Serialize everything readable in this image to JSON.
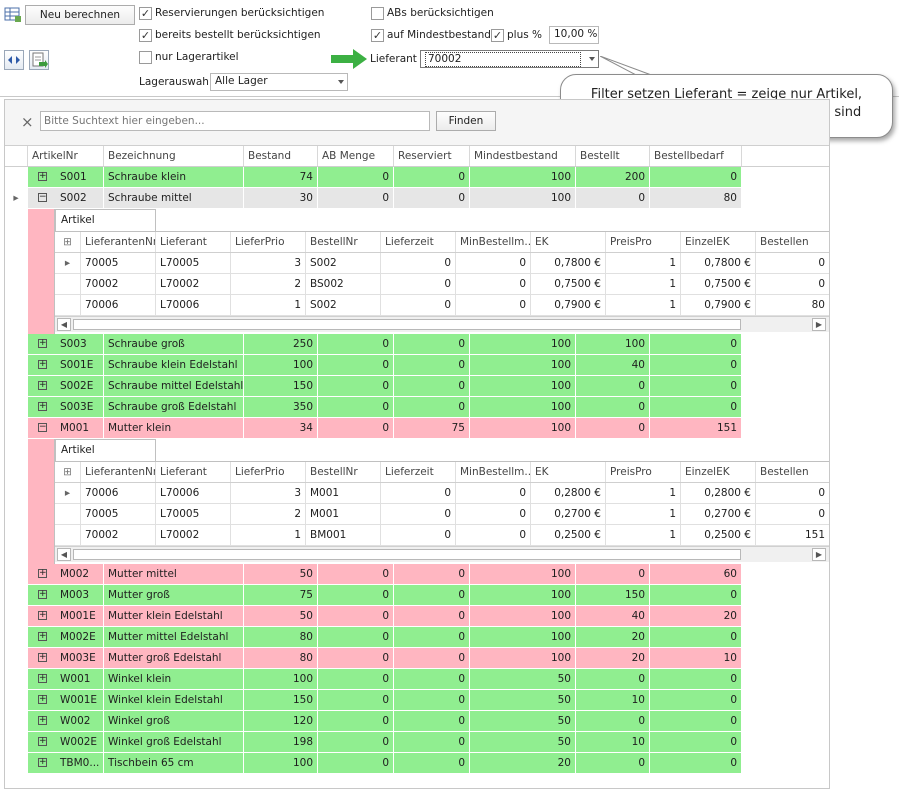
{
  "toolbar": {
    "recalc_label": "Neu berechnen",
    "chk_reservations": {
      "label": "Reservierungen berücksichtigen",
      "checked": true
    },
    "chk_ordered": {
      "label": "bereits bestellt berücksichtigen",
      "checked": true
    },
    "chk_stock_only": {
      "label": "nur Lagerartikel",
      "checked": false
    },
    "chk_abs": {
      "label": "ABs berücksichtigen",
      "checked": false
    },
    "chk_min_stock": {
      "label": "auf Mindestbestand",
      "checked": true
    },
    "chk_plus_percent": {
      "label": "plus %",
      "checked": true
    },
    "percent_value": "10,00 %",
    "supplier_label": "Lieferant",
    "supplier_value": "70002",
    "warehouse_label": "Lagerauswahl",
    "warehouse_value": "Alle Lager",
    "checkmark": "✓"
  },
  "callout": {
    "line1": "Filter setzen Lieferant = zeige nur Artikel,",
    "line2": "die bei diesem Lieferanten erhältlich sind"
  },
  "search": {
    "placeholder": "Bitte Suchtext hier eingeben...",
    "find_label": "Finden",
    "clear_glyph": "×"
  },
  "columns": [
    "ArtikelNr",
    "Bezeichnung",
    "Bestand",
    "AB Menge",
    "Reserviert",
    "Mindestbestand",
    "Bestellt",
    "Bestellbedarf"
  ],
  "rows": [
    {
      "nr": "S001",
      "name": "Schraube klein",
      "bestand": "74",
      "ab": "0",
      "res": "0",
      "min": "100",
      "bestellt": "200",
      "bedarf": "0",
      "color": "green",
      "expanded": false
    },
    {
      "nr": "S002",
      "name": "Schraube mittel",
      "bestand": "30",
      "ab": "0",
      "res": "0",
      "min": "100",
      "bestellt": "0",
      "bedarf": "80",
      "color": "selected",
      "expanded": true
    },
    {
      "nr": "S003",
      "name": "Schraube groß",
      "bestand": "250",
      "ab": "0",
      "res": "0",
      "min": "100",
      "bestellt": "100",
      "bedarf": "0",
      "color": "green",
      "expanded": false
    },
    {
      "nr": "S001E",
      "name": "Schraube klein Edelstahl",
      "bestand": "100",
      "ab": "0",
      "res": "0",
      "min": "100",
      "bestellt": "40",
      "bedarf": "0",
      "color": "green",
      "expanded": false
    },
    {
      "nr": "S002E",
      "name": "Schraube mittel Edelstahl",
      "bestand": "150",
      "ab": "0",
      "res": "0",
      "min": "100",
      "bestellt": "0",
      "bedarf": "0",
      "color": "green",
      "expanded": false
    },
    {
      "nr": "S003E",
      "name": "Schraube groß Edelstahl",
      "bestand": "350",
      "ab": "0",
      "res": "0",
      "min": "100",
      "bestellt": "0",
      "bedarf": "0",
      "color": "green",
      "expanded": false
    },
    {
      "nr": "M001",
      "name": "Mutter klein",
      "bestand": "34",
      "ab": "0",
      "res": "75",
      "min": "100",
      "bestellt": "0",
      "bedarf": "151",
      "color": "pink",
      "expanded": true
    },
    {
      "nr": "M002",
      "name": "Mutter mittel",
      "bestand": "50",
      "ab": "0",
      "res": "0",
      "min": "100",
      "bestellt": "0",
      "bedarf": "60",
      "color": "pink",
      "expanded": false
    },
    {
      "nr": "M003",
      "name": "Mutter groß",
      "bestand": "75",
      "ab": "0",
      "res": "0",
      "min": "100",
      "bestellt": "150",
      "bedarf": "0",
      "color": "green",
      "expanded": false
    },
    {
      "nr": "M001E",
      "name": "Mutter klein Edelstahl",
      "bestand": "50",
      "ab": "0",
      "res": "0",
      "min": "100",
      "bestellt": "40",
      "bedarf": "20",
      "color": "pink",
      "expanded": false
    },
    {
      "nr": "M002E",
      "name": "Mutter mittel Edelstahl",
      "bestand": "80",
      "ab": "0",
      "res": "0",
      "min": "100",
      "bestellt": "20",
      "bedarf": "0",
      "color": "green",
      "expanded": false
    },
    {
      "nr": "M003E",
      "name": "Mutter groß Edelstahl",
      "bestand": "80",
      "ab": "0",
      "res": "0",
      "min": "100",
      "bestellt": "20",
      "bedarf": "10",
      "color": "pink",
      "expanded": false
    },
    {
      "nr": "W001",
      "name": "Winkel klein",
      "bestand": "100",
      "ab": "0",
      "res": "0",
      "min": "50",
      "bestellt": "0",
      "bedarf": "0",
      "color": "green",
      "expanded": false
    },
    {
      "nr": "W001E",
      "name": "Winkel klein Edelstahl",
      "bestand": "150",
      "ab": "0",
      "res": "0",
      "min": "50",
      "bestellt": "10",
      "bedarf": "0",
      "color": "green",
      "expanded": false
    },
    {
      "nr": "W002",
      "name": "Winkel groß",
      "bestand": "120",
      "ab": "0",
      "res": "0",
      "min": "50",
      "bestellt": "0",
      "bedarf": "0",
      "color": "green",
      "expanded": false
    },
    {
      "nr": "W002E",
      "name": "Winkel groß Edelstahl",
      "bestand": "198",
      "ab": "0",
      "res": "0",
      "min": "50",
      "bestellt": "10",
      "bedarf": "0",
      "color": "green",
      "expanded": false
    },
    {
      "nr": "TBM0...",
      "name": "Tischbein 65 cm",
      "bestand": "100",
      "ab": "0",
      "res": "0",
      "min": "20",
      "bestellt": "0",
      "bedarf": "0",
      "color": "green",
      "expanded": false
    }
  ],
  "detail_tab_label": "Artikel Lieferanten",
  "detail_columns": [
    "LieferantenNr",
    "Lieferant",
    "LieferPrio",
    "BestellNr",
    "Lieferzeit",
    "MinBestellm...",
    "EK",
    "PreisPro",
    "EinzelEK",
    "Bestellen"
  ],
  "details": {
    "S002": [
      {
        "nr": "70005",
        "lief": "L70005",
        "prio": "3",
        "bnr": "S002",
        "zeit": "0",
        "minb": "0",
        "ek": "0,7800 €",
        "pp": "1",
        "eek": "0,7800 €",
        "best": "0"
      },
      {
        "nr": "70002",
        "lief": "L70002",
        "prio": "2",
        "bnr": "BS002",
        "zeit": "0",
        "minb": "0",
        "ek": "0,7500 €",
        "pp": "1",
        "eek": "0,7500 €",
        "best": "0"
      },
      {
        "nr": "70006",
        "lief": "L70006",
        "prio": "1",
        "bnr": "S002",
        "zeit": "0",
        "minb": "0",
        "ek": "0,7900 €",
        "pp": "1",
        "eek": "0,7900 €",
        "best": "80"
      }
    ],
    "M001": [
      {
        "nr": "70006",
        "lief": "L70006",
        "prio": "3",
        "bnr": "M001",
        "zeit": "0",
        "minb": "0",
        "ek": "0,2800 €",
        "pp": "1",
        "eek": "0,2800 €",
        "best": "0"
      },
      {
        "nr": "70005",
        "lief": "L70005",
        "prio": "2",
        "bnr": "M001",
        "zeit": "0",
        "minb": "0",
        "ek": "0,2700 €",
        "pp": "1",
        "eek": "0,2700 €",
        "best": "0"
      },
      {
        "nr": "70002",
        "lief": "L70002",
        "prio": "1",
        "bnr": "BM001",
        "zeit": "0",
        "minb": "0",
        "ek": "0,2500 €",
        "pp": "1",
        "eek": "0,2500 €",
        "best": "151"
      }
    ]
  },
  "colors": {
    "green": "#90ee90",
    "pink": "#ffb6c1",
    "arrow": "#3cb043",
    "selected": "#e6e6e6"
  },
  "icons": {
    "expand": "+",
    "collapse": "−",
    "row_indicator": "▸",
    "scroll_left": "◀",
    "scroll_right": "▶"
  }
}
